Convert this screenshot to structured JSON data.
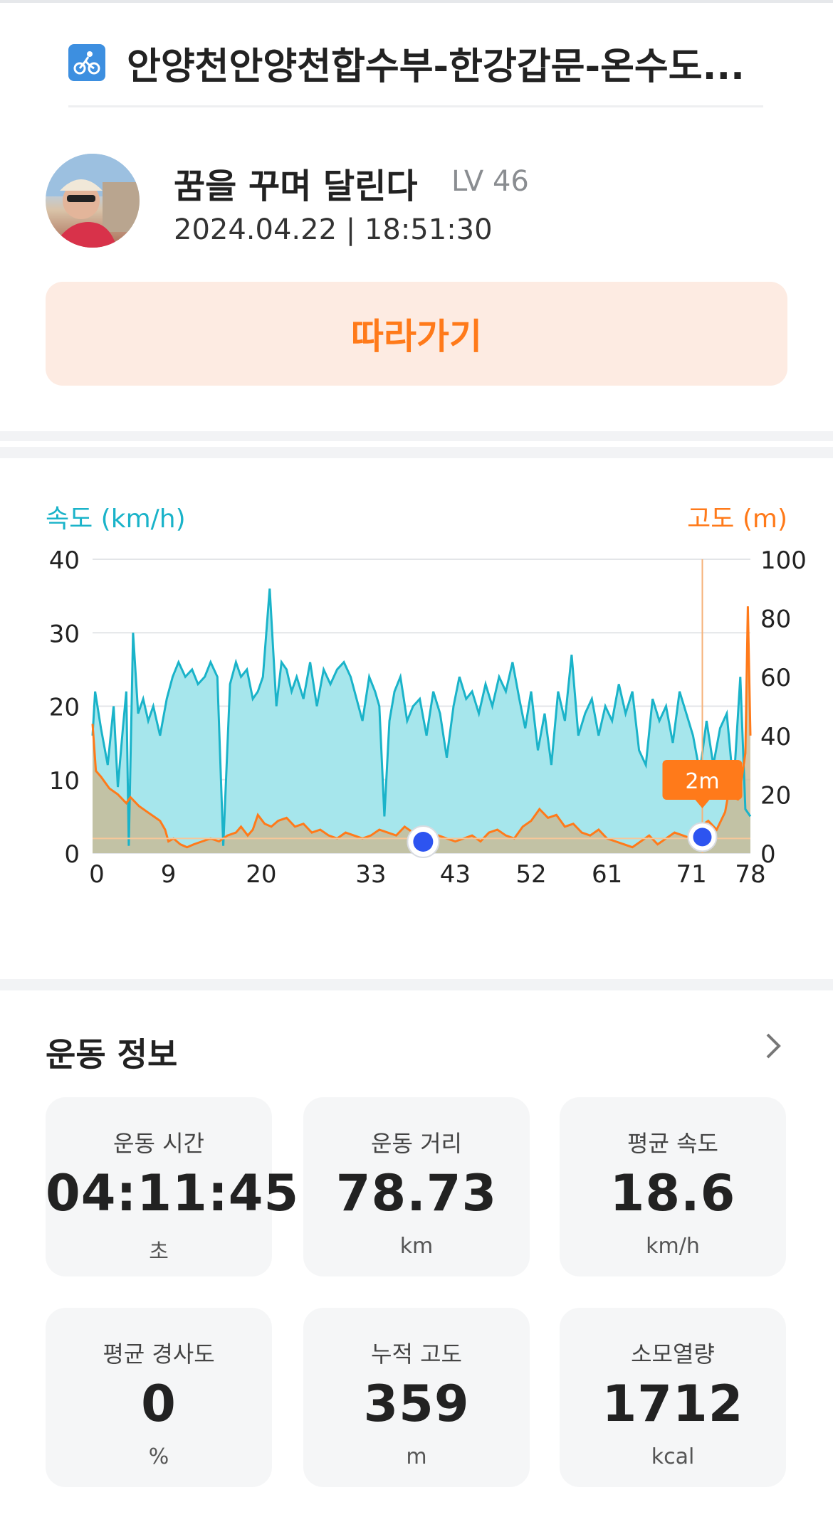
{
  "header": {
    "title": "안양천안양천합수부-한강갑문-온수도...",
    "icon": "cycling-route-icon"
  },
  "user": {
    "name": "꿈을 꾸며 달린다",
    "level": "LV 46",
    "datetime": "2024.04.22 | 18:51:30"
  },
  "follow_button": {
    "label": "따라가기"
  },
  "chart_data": {
    "type": "area",
    "left_axis_label": "속도 (km/h)",
    "right_axis_label": "고도 (m)",
    "x_ticks": [
      "0",
      "9",
      "20",
      "33",
      "43",
      "52",
      "61",
      "71",
      "78"
    ],
    "y_left_ticks": [
      "40",
      "30",
      "20",
      "10",
      "0"
    ],
    "y_right_ticks": [
      "100",
      "80",
      "60",
      "40",
      "20",
      "0"
    ],
    "y_left_range": [
      0,
      40
    ],
    "y_right_range": [
      0,
      100
    ],
    "x_range": [
      0,
      78
    ],
    "tooltip": {
      "label": "2m",
      "x": 72.3
    },
    "markers": [
      {
        "x": 39.2
      }
    ],
    "series": [
      {
        "name": "속도 (km/h)",
        "color": "#1ab3c9",
        "x": [
          0,
          0.3,
          1.0,
          1.8,
          2.5,
          3.0,
          3.6,
          4.0,
          4.3,
          4.8,
          5.4,
          6.0,
          6.6,
          7.2,
          8.0,
          8.8,
          9.5,
          10.2,
          11.0,
          11.8,
          12.5,
          13.3,
          14.0,
          14.8,
          15.5,
          16.3,
          17.0,
          17.6,
          18.3,
          19.0,
          19.6,
          20.2,
          21.0,
          21.8,
          22.4,
          23.0,
          23.6,
          24.2,
          25.0,
          25.8,
          26.6,
          27.4,
          28.2,
          29.0,
          29.8,
          30.6,
          31.3,
          32.0,
          32.8,
          33.5,
          34.0,
          34.6,
          35.2,
          35.8,
          36.5,
          37.3,
          38.0,
          38.8,
          39.6,
          40.4,
          41.2,
          42.0,
          42.8,
          43.5,
          44.3,
          45.0,
          45.8,
          46.6,
          47.4,
          48.2,
          49.0,
          49.8,
          50.6,
          51.3,
          52.0,
          52.8,
          53.6,
          54.4,
          55.2,
          56.0,
          56.8,
          57.6,
          58.4,
          59.2,
          60.0,
          60.8,
          61.6,
          62.4,
          63.2,
          64.0,
          64.8,
          65.6,
          66.4,
          67.2,
          68.0,
          68.8,
          69.6,
          70.4,
          71.2,
          72.0,
          72.8,
          73.6,
          74.4,
          75.2,
          76.0,
          76.8,
          77.4,
          78.0
        ],
        "values": [
          16,
          22,
          17,
          12,
          20,
          9,
          17,
          22,
          1,
          30,
          19,
          21,
          18,
          20,
          16,
          21,
          24,
          26,
          24,
          25,
          23,
          24,
          26,
          24,
          1,
          23,
          26,
          24,
          25,
          21,
          22,
          24,
          36,
          20,
          26,
          25,
          22,
          24,
          21,
          26,
          20,
          25,
          23,
          25,
          26,
          24,
          21,
          18,
          24,
          22,
          20,
          5,
          18,
          22,
          24,
          18,
          20,
          21,
          16,
          22,
          19,
          13,
          20,
          24,
          21,
          22,
          19,
          23,
          20,
          24,
          22,
          26,
          21,
          17,
          22,
          14,
          19,
          12,
          22,
          18,
          27,
          16,
          19,
          21,
          16,
          20,
          18,
          23,
          19,
          22,
          14,
          12,
          21,
          18,
          20,
          15,
          22,
          19,
          16,
          11,
          18,
          12,
          17,
          19,
          9,
          24,
          6,
          5
        ]
      },
      {
        "name": "고도 (m)",
        "color": "#ff7a1a",
        "x": [
          0,
          0.4,
          1.0,
          2.0,
          3.0,
          4.0,
          4.5,
          5.5,
          6.5,
          7.5,
          8.0,
          8.6,
          9.0,
          9.6,
          10.4,
          11.2,
          12.0,
          13.0,
          14.0,
          15.0,
          16.0,
          17.0,
          17.6,
          18.4,
          19.0,
          19.6,
          20.4,
          21.2,
          22.0,
          23.0,
          24.0,
          25.0,
          26.0,
          27.0,
          28.0,
          29.0,
          30.0,
          31.0,
          32.0,
          33.0,
          34.0,
          35.0,
          36.0,
          37.0,
          38.0,
          39.0,
          40.0,
          41.0,
          42.0,
          43.0,
          44.0,
          45.0,
          46.0,
          47.0,
          48.0,
          49.0,
          50.0,
          51.0,
          52.0,
          53.0,
          54.0,
          55.0,
          56.0,
          57.0,
          58.0,
          59.0,
          60.0,
          61.0,
          62.0,
          63.0,
          64.0,
          65.0,
          66.0,
          67.0,
          68.0,
          69.0,
          70.0,
          71.0,
          72.0,
          73.0,
          74.0,
          75.0,
          76.0,
          76.5,
          77.0,
          77.4,
          77.7,
          78.0
        ],
        "values": [
          44,
          28,
          26,
          22,
          20,
          17,
          19,
          16,
          14,
          12,
          11,
          8,
          4,
          5,
          3,
          2,
          3,
          4,
          5,
          4,
          6,
          7,
          9,
          6,
          8,
          13,
          10,
          9,
          11,
          12,
          9,
          10,
          7,
          8,
          6,
          5,
          7,
          6,
          5,
          6,
          8,
          7,
          6,
          9,
          7,
          5,
          4,
          6,
          5,
          4,
          5,
          6,
          4,
          7,
          8,
          6,
          5,
          9,
          11,
          15,
          12,
          13,
          9,
          10,
          7,
          6,
          8,
          5,
          4,
          3,
          2,
          4,
          6,
          3,
          5,
          7,
          6,
          5,
          9,
          11,
          8,
          14,
          30,
          18,
          26,
          34,
          84,
          40
        ]
      }
    ]
  },
  "workout": {
    "title": "운동 정보",
    "stats": [
      {
        "label": "운동 시간",
        "value": "04:11:45",
        "unit": "초"
      },
      {
        "label": "운동 거리",
        "value": "78.73",
        "unit": "km"
      },
      {
        "label": "평균 속도",
        "value": "18.6",
        "unit": "km/h"
      },
      {
        "label": "평균 경사도",
        "value": "0",
        "unit": "%"
      },
      {
        "label": "누적 고도",
        "value": "359",
        "unit": "m"
      },
      {
        "label": "소모열량",
        "value": "1712",
        "unit": "kcal"
      }
    ]
  }
}
